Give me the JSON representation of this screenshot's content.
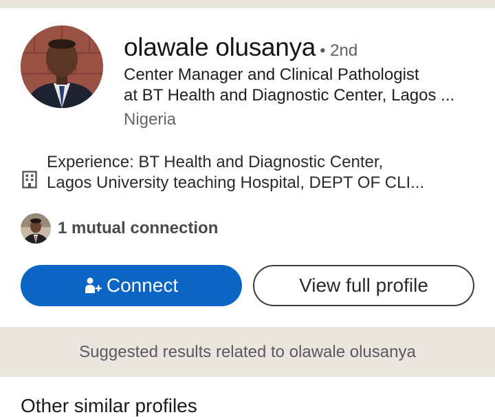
{
  "profile": {
    "name": "olawale olusanya",
    "degree": "• 2nd",
    "headline_line1": "Center Manager and Clinical Pathologist",
    "headline_line2": "at BT Health and Diagnostic Center, Lagos ...",
    "location": "Nigeria",
    "experience_line1": "Experience: BT Health and Diagnostic Center,",
    "experience_line2": "Lagos University teaching Hospital, DEPT OF CLI...",
    "mutual": "1 mutual connection"
  },
  "actions": {
    "connect_label": "Connect",
    "view_profile_label": "View full profile"
  },
  "suggested": {
    "text": "Suggested results related to olawale olusanya"
  },
  "section": {
    "other_title": "Other similar profiles"
  },
  "icons": {
    "experience": "building-icon",
    "connect": "add-person-icon"
  },
  "colors": {
    "primary": "#0a66c2",
    "band": "#e9e5df"
  }
}
